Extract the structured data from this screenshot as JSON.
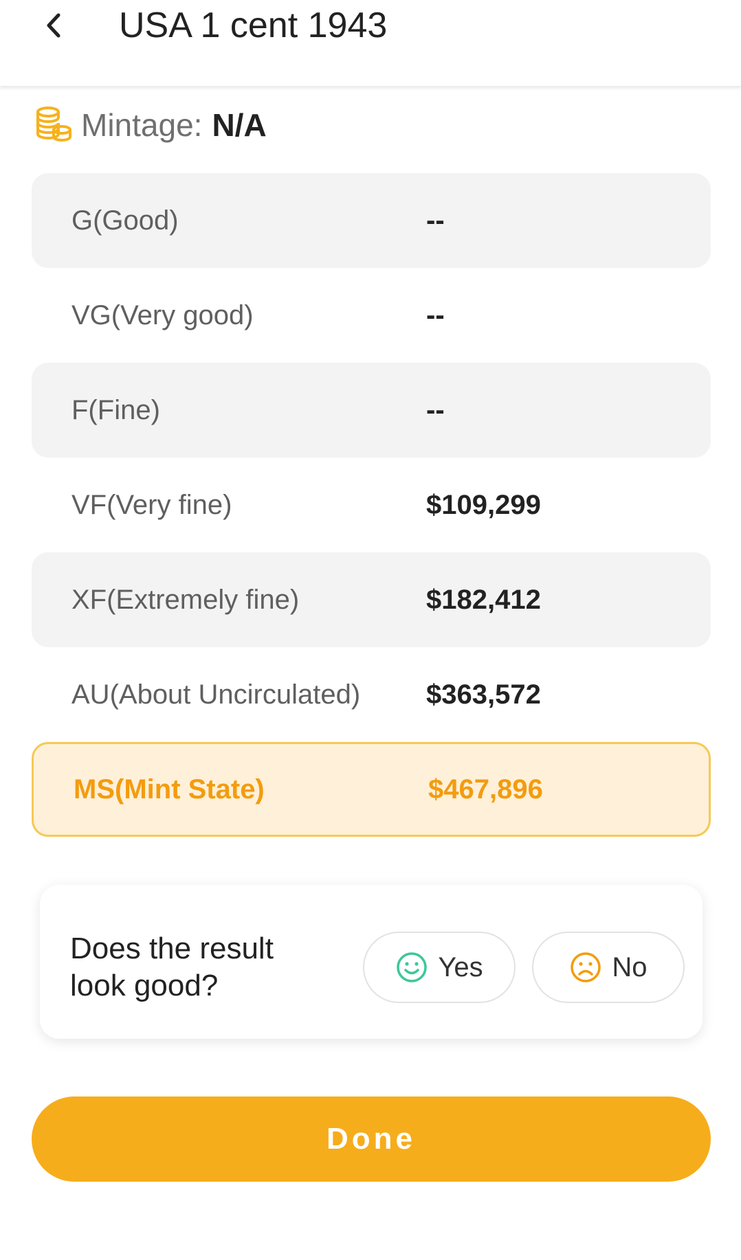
{
  "header": {
    "title": "USA 1 cent 1943",
    "back_icon": "chevron-left-icon"
  },
  "mintage": {
    "icon": "coins-stack-icon",
    "label": "Mintage:",
    "value": "N/A"
  },
  "grades": [
    {
      "name": "G(Good)",
      "price": "--"
    },
    {
      "name": "VG(Very good)",
      "price": "--"
    },
    {
      "name": "F(Fine)",
      "price": "--"
    },
    {
      "name": "VF(Very fine)",
      "price": "$109,299"
    },
    {
      "name": "XF(Extremely fine)",
      "price": "$182,412"
    },
    {
      "name": "AU(About Uncirculated)",
      "price": "$363,572"
    },
    {
      "name": "MS(Mint State)",
      "price": "$467,896"
    }
  ],
  "feedback": {
    "question": "Does the result look good?",
    "yes_label": "Yes",
    "yes_icon": "smile-face-icon",
    "no_label": "No",
    "no_icon": "frown-face-icon"
  },
  "done_label": "Done",
  "colors": {
    "accent": "#f6ad1b",
    "highlight_text": "#f39c0e",
    "highlight_bg": "#fff0d9",
    "highlight_border": "#f6c954",
    "yes_green": "#3cc79a",
    "no_orange": "#f39c0e"
  }
}
